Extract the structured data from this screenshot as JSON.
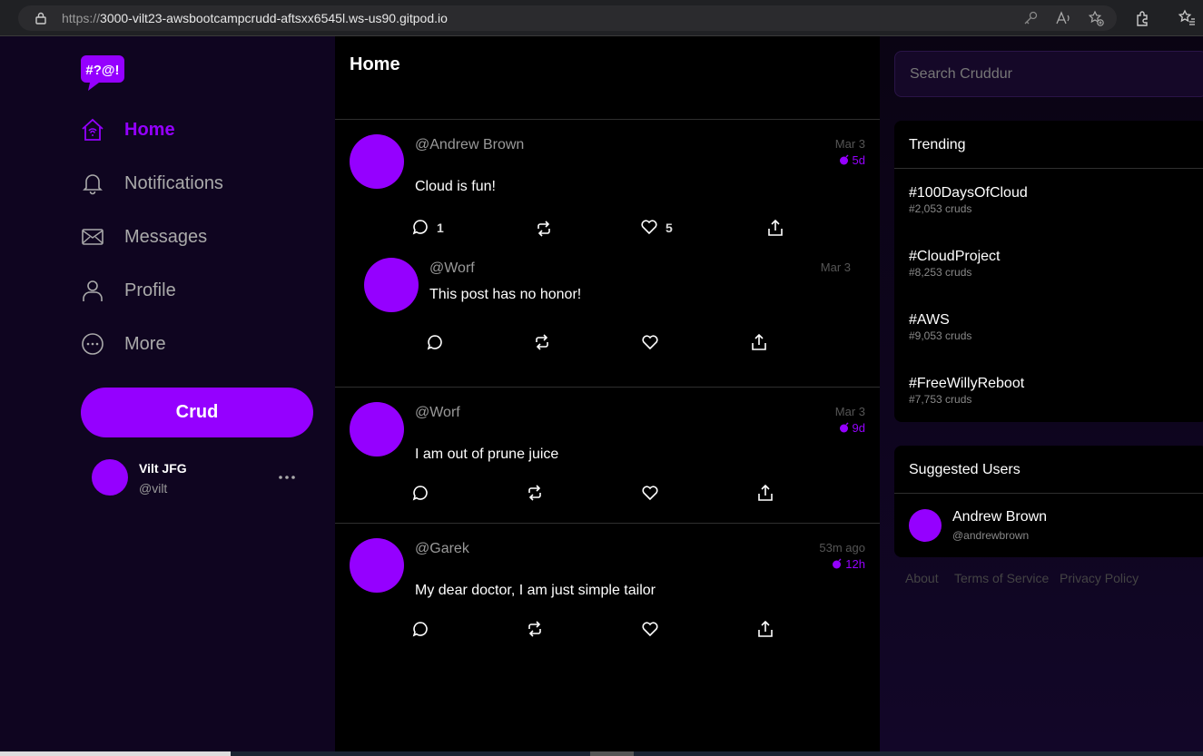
{
  "browser": {
    "url_scheme": "https://",
    "url_rest": "3000-vilt23-awsbootcampcrudd-aftsxx6545l.ws-us90.gitpod.io"
  },
  "sidebar": {
    "logo_text": "#?@!",
    "nav": [
      {
        "label": "Home",
        "icon": "home-icon",
        "active": true
      },
      {
        "label": "Notifications",
        "icon": "bell-icon",
        "active": false
      },
      {
        "label": "Messages",
        "icon": "envelope-icon",
        "active": false
      },
      {
        "label": "Profile",
        "icon": "person-icon",
        "active": false
      },
      {
        "label": "More",
        "icon": "more-circle-icon",
        "active": false
      }
    ],
    "crud_button": "Crud",
    "user": {
      "name": "Vilt JFG",
      "handle": "@vilt"
    }
  },
  "feed": {
    "title": "Home",
    "activities": [
      {
        "handle": "@Andrew Brown",
        "message": "Cloud is fun!",
        "date": "Mar 3",
        "expires": "5d",
        "replies": "1",
        "likes": "5",
        "reply": {
          "handle": "@Worf",
          "message": "This post has no honor!",
          "date": "Mar 3"
        }
      },
      {
        "handle": "@Worf",
        "message": "I am out of prune juice",
        "date": "Mar 3",
        "expires": "9d"
      },
      {
        "handle": "@Garek",
        "message": "My dear doctor, I am just simple tailor",
        "date": "53m ago",
        "expires": "12h"
      }
    ]
  },
  "right": {
    "search_placeholder": "Search Cruddur",
    "trending_title": "Trending",
    "trends": [
      {
        "tag": "#100DaysOfCloud",
        "count": "#2,053 cruds"
      },
      {
        "tag": "#CloudProject",
        "count": "#8,253 cruds"
      },
      {
        "tag": "#AWS",
        "count": "#9,053 cruds"
      },
      {
        "tag": "#FreeWillyReboot",
        "count": "#7,753 cruds"
      }
    ],
    "suggested_title": "Suggested Users",
    "suggested": {
      "name": "Andrew Brown",
      "handle": "@andrewbrown"
    },
    "footer": [
      "About",
      "Terms of Service",
      "Privacy Policy"
    ]
  },
  "colors": {
    "accent": "#9500ff",
    "sidebar_bg": "#0f0520",
    "feed_bg": "#000000"
  }
}
